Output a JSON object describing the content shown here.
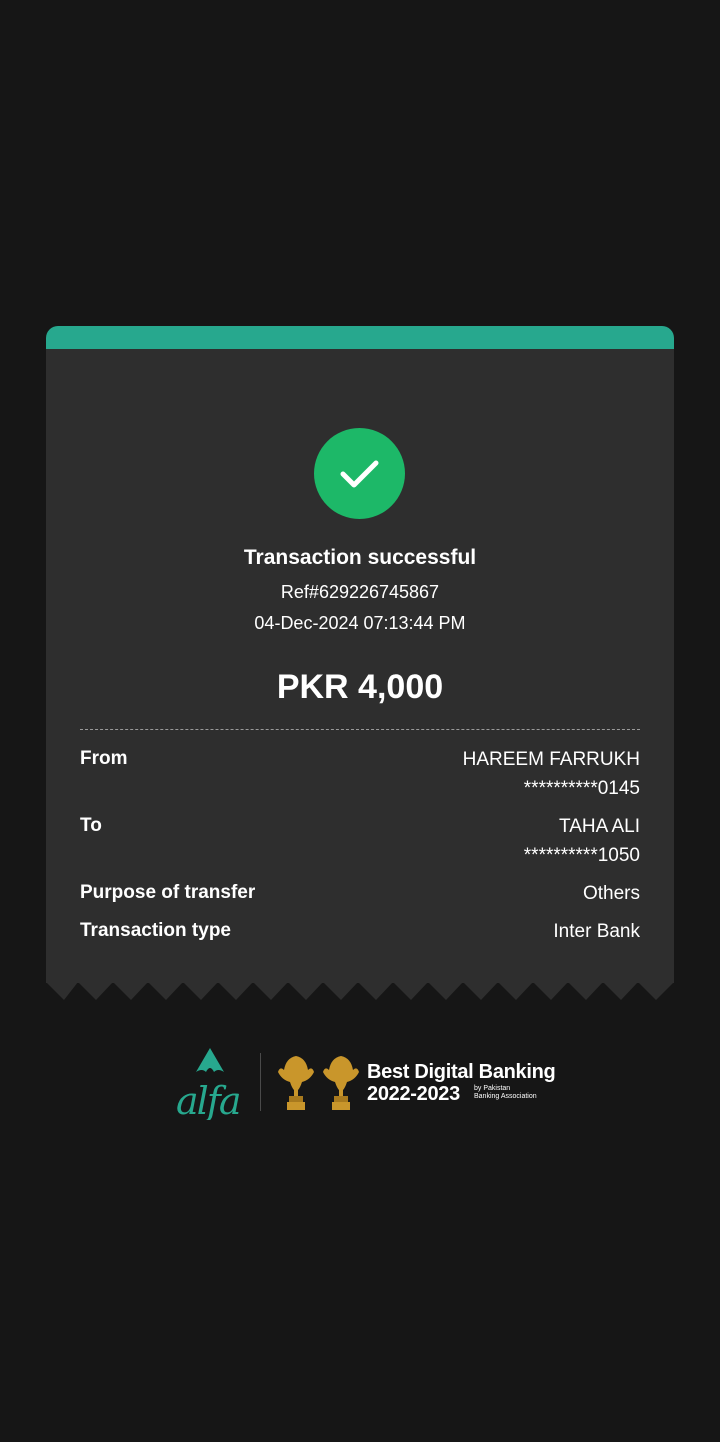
{
  "receipt": {
    "status_title": "Transaction successful",
    "reference": "Ref#629226745867",
    "datetime": "04-Dec-2024 07:13:44 PM",
    "amount": "PKR 4,000",
    "rows": [
      {
        "label": "From",
        "value_line1": "HAREEM FARRUKH",
        "value_line2": "**********0145"
      },
      {
        "label": "To",
        "value_line1": "TAHA ALI",
        "value_line2": "**********1050"
      },
      {
        "label": "Purpose of transfer",
        "value_line1": "Others"
      },
      {
        "label": "Transaction type",
        "value_line1": "Inter Bank"
      }
    ],
    "icon": "check-icon"
  },
  "footer": {
    "brand": "alfa",
    "award_title": "Best Digital Banking",
    "award_years": "2022-2023",
    "award_by_line1": "by Pakistan",
    "award_by_line2": "Banking Association",
    "icons": [
      "alfa-logo-icon",
      "trophy-icon",
      "trophy-icon"
    ]
  },
  "colors": {
    "background": "#161616",
    "card": "#2e2e2e",
    "accent": "#27a88e",
    "success": "#1db868",
    "trophy_gold": "#c9962b"
  }
}
